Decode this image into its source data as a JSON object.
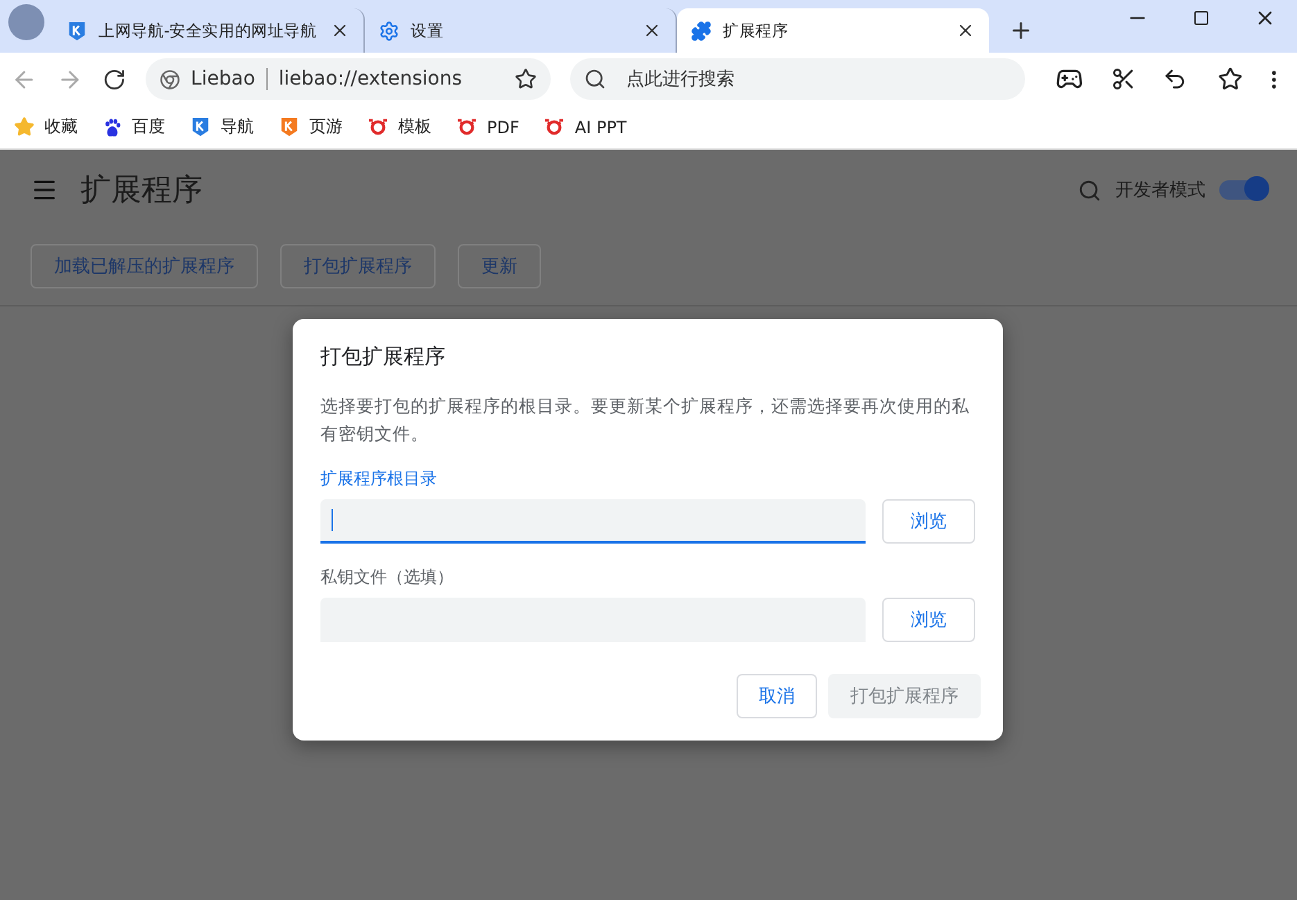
{
  "tabs": [
    {
      "title": "上网导航-安全实用的网址导航",
      "kind": "nav",
      "selected": false
    },
    {
      "title": "设置",
      "kind": "settings",
      "selected": false
    },
    {
      "title": "扩展程序",
      "kind": "extensions",
      "selected": true
    }
  ],
  "toolbar": {
    "site_label": "Liebao",
    "url": "liebao://extensions",
    "search": {
      "placeholder": "点此进行搜索"
    }
  },
  "bookmarks": [
    {
      "label": "收藏",
      "kind": "star"
    },
    {
      "label": "百度",
      "kind": "paw"
    },
    {
      "label": "导航",
      "kind": "k-blue"
    },
    {
      "label": "页游",
      "kind": "k-orange"
    },
    {
      "label": "模板",
      "kind": "red-logo"
    },
    {
      "label": "PDF",
      "kind": "red-logo"
    },
    {
      "label": "AI PPT",
      "kind": "red-logo"
    }
  ],
  "page": {
    "title": "扩展程序",
    "dev_mode": {
      "label": "开发者模式",
      "on": true
    },
    "actions": [
      "加载已解压的扩展程序",
      "打包扩展程序",
      "更新"
    ]
  },
  "dialog": {
    "title": "打包扩展程序",
    "description": "选择要打包的扩展程序的根目录。要更新某个扩展程序，还需选择要再次使用的私有密钥文件。",
    "fields": [
      {
        "label": "扩展程序根目录",
        "focused": true,
        "browse": "浏览"
      },
      {
        "label": "私钥文件（选填）",
        "focused": false,
        "browse": "浏览"
      }
    ],
    "buttons": [
      {
        "label": "取消",
        "disabled": false
      },
      {
        "label": "打包扩展程序",
        "disabled": true
      }
    ]
  }
}
